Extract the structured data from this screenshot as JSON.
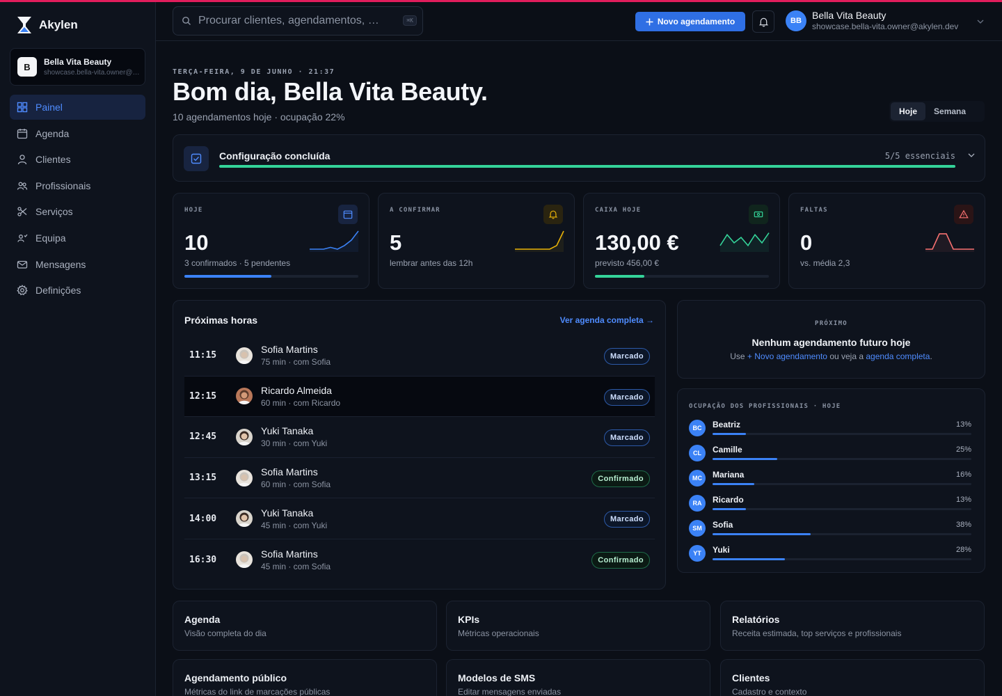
{
  "app": {
    "name": "Akylen"
  },
  "tenant": {
    "initial": "B",
    "name": "Bella Vita Beauty",
    "email": "showcase.bella-vita.owner@akylen.dev"
  },
  "nav": [
    {
      "id": "painel",
      "label": "Painel",
      "icon": "dashboard-icon",
      "active": true
    },
    {
      "id": "agenda",
      "label": "Agenda",
      "icon": "calendar-icon"
    },
    {
      "id": "clientes",
      "label": "Clientes",
      "icon": "user-icon"
    },
    {
      "id": "profissionais",
      "label": "Profissionais",
      "icon": "users-icon"
    },
    {
      "id": "servicos",
      "label": "Serviços",
      "icon": "scissors-icon"
    },
    {
      "id": "equipa",
      "label": "Equipa",
      "icon": "team-icon"
    },
    {
      "id": "mensagens",
      "label": "Mensagens",
      "icon": "mail-icon"
    },
    {
      "id": "definicoes",
      "label": "Definições",
      "icon": "settings-icon"
    }
  ],
  "header": {
    "search_placeholder": "Procurar clientes, agendamentos, …",
    "shortcut": "⌘K",
    "new_button": "Novo agendamento",
    "user": {
      "initials": "BB",
      "name": "Bella Vita Beauty",
      "email": "showcase.bella-vita.owner@akylen.dev"
    }
  },
  "hero": {
    "eyebrow": "TERÇA-FEIRA, 9 DE JUNHO · 21:37",
    "greeting": "Bom dia, Bella Vita Beauty.",
    "subline": "10 agendamentos hoje · ocupação 22%",
    "range": {
      "today": "Hoje",
      "week": "Semana",
      "selected": "Hoje"
    }
  },
  "setup": {
    "title": "Configuração concluída",
    "count": "5/5 essenciais",
    "progress": 1.0
  },
  "kpis": [
    {
      "id": "hoje",
      "label": "HOJE",
      "value": "10",
      "sub": "3 confirmados · 5 pendentes",
      "icon": "calendar-icon",
      "color": "#3b82f6",
      "progress": 0.5,
      "spark": [
        2,
        2,
        2,
        1.8,
        2,
        1.6,
        1,
        0
      ]
    },
    {
      "id": "confirmar",
      "label": "A CONFIRMAR",
      "value": "5",
      "sub": "lembrar antes das 12h",
      "icon": "bell-icon",
      "color": "#eab308",
      "progress": null,
      "spark": [
        2,
        2,
        2,
        2,
        2,
        2,
        1.6,
        0
      ]
    },
    {
      "id": "caixa",
      "label": "CAIXA HOJE",
      "value": "130,00 €",
      "sub": "previsto 456,00 €",
      "icon": "cash-icon",
      "color": "#34d399",
      "progress": 0.285,
      "spark": [
        1.6,
        0.4,
        1.3,
        0.7,
        1.6,
        0.4,
        1.3,
        0.2
      ]
    },
    {
      "id": "faltas",
      "label": "FALTAS",
      "value": "0",
      "sub": "vs. média 2,3",
      "icon": "alert-icon",
      "color": "#f87171",
      "progress": null,
      "spark": [
        2,
        2,
        0.3,
        0.3,
        2,
        2,
        2,
        2
      ]
    }
  ],
  "upcoming": {
    "title": "Próximas horas",
    "link": "Ver agenda completa →",
    "rows": [
      {
        "time": "11:15",
        "name": "Sofia Martins",
        "meta": "75 min · com Sofia",
        "status": "Marcado",
        "tone": "blue",
        "avatar": "a"
      },
      {
        "time": "12:15",
        "name": "Ricardo Almeida",
        "meta": "60 min · com Ricardo",
        "status": "Marcado",
        "tone": "blue",
        "avatar": "b",
        "highlight": true
      },
      {
        "time": "12:45",
        "name": "Yuki Tanaka",
        "meta": "30 min · com Yuki",
        "status": "Marcado",
        "tone": "blue",
        "avatar": "c"
      },
      {
        "time": "13:15",
        "name": "Sofia Martins",
        "meta": "60 min · com Sofia",
        "status": "Confirmado",
        "tone": "green",
        "avatar": "a"
      },
      {
        "time": "14:00",
        "name": "Yuki Tanaka",
        "meta": "45 min · com Yuki",
        "status": "Marcado",
        "tone": "blue",
        "avatar": "c"
      },
      {
        "time": "16:30",
        "name": "Sofia Martins",
        "meta": "45 min · com Sofia",
        "status": "Confirmado",
        "tone": "green",
        "avatar": "a"
      }
    ]
  },
  "next": {
    "label": "PRÓXIMO",
    "title": "Nenhum agendamento futuro hoje",
    "text_pre": "Use",
    "link1": "+ Novo agendamento",
    "text_mid": "ou veja a",
    "link2": "agenda completa",
    "text_end": "."
  },
  "occupancy": {
    "label": "OCUPAÇÃO DOS PROFISSIONAIS · HOJE",
    "rows": [
      {
        "initials": "BC",
        "name": "Beatriz",
        "pct_label": "13%",
        "value": 0.13
      },
      {
        "initials": "CL",
        "name": "Camille",
        "pct_label": "25%",
        "value": 0.25
      },
      {
        "initials": "MC",
        "name": "Mariana",
        "pct_label": "16%",
        "value": 0.16
      },
      {
        "initials": "RA",
        "name": "Ricardo",
        "pct_label": "13%",
        "value": 0.13
      },
      {
        "initials": "SM",
        "name": "Sofia",
        "pct_label": "38%",
        "value": 0.38
      },
      {
        "initials": "YT",
        "name": "Yuki",
        "pct_label": "28%",
        "value": 0.28
      }
    ]
  },
  "quick_links": [
    {
      "title": "Agenda",
      "sub": "Visão completa do dia"
    },
    {
      "title": "KPIs",
      "sub": "Métricas operacionais"
    },
    {
      "title": "Relatórios",
      "sub": "Receita estimada, top serviços e profissionais"
    },
    {
      "title": "Agendamento público",
      "sub": "Métricas do link de marcações públicas"
    },
    {
      "title": "Modelos de SMS",
      "sub": "Editar mensagens enviadas"
    },
    {
      "title": "Clientes",
      "sub": "Cadastro e contexto"
    }
  ]
}
